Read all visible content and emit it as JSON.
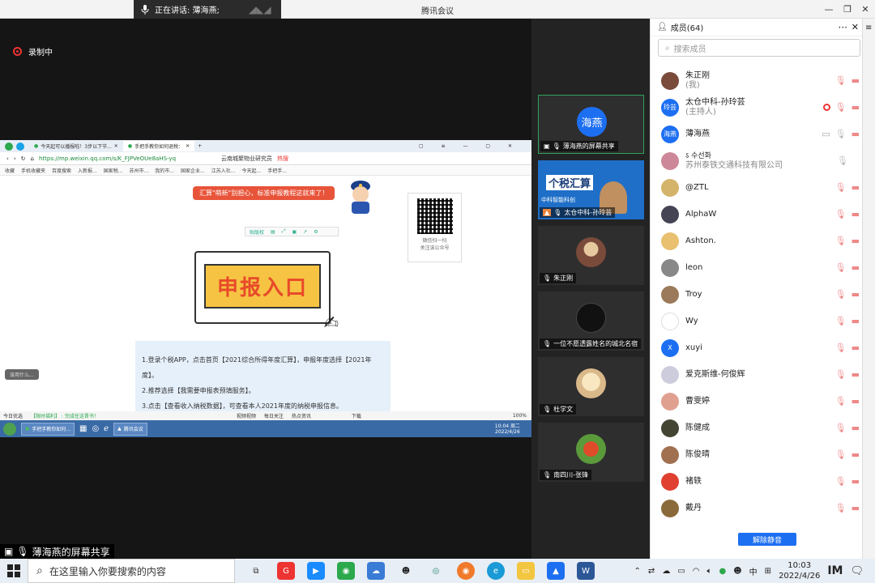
{
  "titlebar": {
    "speaking_text": "正在讲话: 薄海燕;",
    "app_title": "腾讯会议"
  },
  "recording": {
    "label": "录制中"
  },
  "shared_screen": {
    "tabs": [
      "今天起可以播报啦！3步以下节...",
      "手把手教你如何退税："
    ],
    "url": "https://mp.weixin.qq.com/s/K_FJPVeOUe8aHS-yq",
    "bookmarks": [
      "收藏",
      "手机收藏夹",
      "百度搜索",
      "入新报...",
      "国家税...",
      "苏州市...",
      "我的市...",
      "国家企业...",
      "江苏入社...",
      "今天起...",
      "手把手..."
    ],
    "search_placeholder": "云南城聚物业研究员",
    "hot": "热搜",
    "banner": "汇算\"萌新\"别担心，标准申报教程这就来了！",
    "mini_toolbar": [
      "贴版权"
    ],
    "qr_caption_1": "微信扫一扫",
    "qr_caption_2": "关注该公众号",
    "sb_title": "申报入口",
    "steps": [
      "1.登录个税APP，点击首页【2021综合所得年度汇算】，申报年度选择【2021年度】。",
      "2.推荐选择【我需要申报表预填服务】。",
      "3.点击【查看收入纳税数据】，可查看本人2021年度的纳税申报信息。"
    ],
    "switch_tip": "该用什么...",
    "statusbar": [
      "今日优选",
      "【限时福利】 : 完成任送晋书！",
      "视频视频",
      "每日关注",
      "热点资讯",
      "下载",
      "100%"
    ],
    "inner_taskbar": [
      "手把手教你如何...",
      "腾讯会议"
    ],
    "inner_clock_time": "10:04 周二",
    "inner_clock_date": "2022/4/26",
    "share_label": "薄海燕的屏幕共享"
  },
  "videos": [
    {
      "name": "薄海燕的屏幕共享",
      "avatar_text": "海燕"
    },
    {
      "name": "太仓中科-孙玲芸",
      "overlay_title": "个税汇算",
      "overlay_sub": "中科智能科创"
    },
    {
      "name": "朱正刚"
    },
    {
      "name": "一位不愿透露姓名的城北名宿"
    },
    {
      "name": "杜学文"
    },
    {
      "name": "南四川-张锋"
    }
  ],
  "members": {
    "header": "成员(64)",
    "search_placeholder": "搜索成员",
    "list": [
      {
        "name": "朱正刚",
        "sub": "(我)",
        "color": "#7a4a3a"
      },
      {
        "name": "太仓中科-孙玲芸",
        "sub": "(主持人)",
        "avatar_text": "玲芸",
        "color": "#1d6ff2",
        "recording": true
      },
      {
        "name": "薄海燕",
        "avatar_text": "海燕",
        "color": "#1d6ff2",
        "sharing": true
      },
      {
        "name": "苏州泰铁交通科技有限公司",
        "prefix": "ऽ 수선화",
        "color": "#c89"
      },
      {
        "name": "@ZTL",
        "color": "#d4b46a"
      },
      {
        "name": "AlphaW",
        "color": "#445"
      },
      {
        "name": "Ashton.",
        "color": "#e8c070"
      },
      {
        "name": "leon",
        "color": "#888"
      },
      {
        "name": "Troy",
        "color": "#9a7a5a"
      },
      {
        "name": "Wy",
        "color": "#fff"
      },
      {
        "name": "xuyi",
        "avatar_text": "X",
        "color": "#1d6ff2"
      },
      {
        "name": "爱克斯维-何俊辉",
        "color": "#ccd"
      },
      {
        "name": "曹雯婷",
        "color": "#e0a090"
      },
      {
        "name": "陈健成",
        "color": "#443"
      },
      {
        "name": "陈俊晴",
        "color": "#a07050"
      },
      {
        "name": "褚轶",
        "color": "#e04030"
      },
      {
        "name": "戴丹",
        "color": "#8a6a3a"
      }
    ],
    "unmute_label": "解除静音"
  },
  "taskbar": {
    "search_placeholder": "在这里输入你要搜索的内容",
    "ime": "中",
    "time": "10:03",
    "date": "2022/4/26"
  }
}
